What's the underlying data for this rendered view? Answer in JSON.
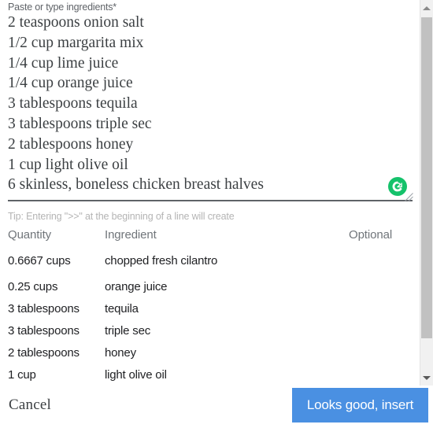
{
  "dialog": {
    "ingredients_field": {
      "label": "Paste or type ingredients*",
      "value": "2 teaspoons onion salt\n1/2 cup margarita mix\n1/4 cup lime juice\n1/4 cup orange juice\n3 tablespoons tequila\n3 tablespoons triple sec\n2 tablespoons honey\n1 cup light olive oil\n6 skinless, boneless chicken breast halves",
      "placeholder": "Paste or type ingredients",
      "grammarly_icon": "grammarly-icon"
    },
    "tip": "Tip: Entering \">>\" at the beginning of a line will create",
    "table": {
      "headers": [
        "Quantity",
        "Ingredient",
        "Optional"
      ],
      "rows": [
        {
          "quantity": "0.6667 cups",
          "ingredient": "chopped fresh cilantro",
          "optional": ""
        },
        {
          "quantity": "0.25 cups",
          "ingredient": "orange juice",
          "optional": ""
        },
        {
          "quantity": "3 tablespoons",
          "ingredient": "tequila",
          "optional": ""
        },
        {
          "quantity": "3 tablespoons",
          "ingredient": "triple sec",
          "optional": ""
        },
        {
          "quantity": "2 tablespoons",
          "ingredient": "honey",
          "optional": ""
        },
        {
          "quantity": "1 cup",
          "ingredient": "light olive oil",
          "optional": ""
        }
      ]
    },
    "footer": {
      "cancel_label": "Cancel",
      "insert_label": "Looks good, insert",
      "insert_color": "#4a90e2"
    },
    "scrollbar": {
      "up_arrow_icon": "chevron-up-icon",
      "down_arrow_icon": "chevron-down-icon"
    }
  }
}
